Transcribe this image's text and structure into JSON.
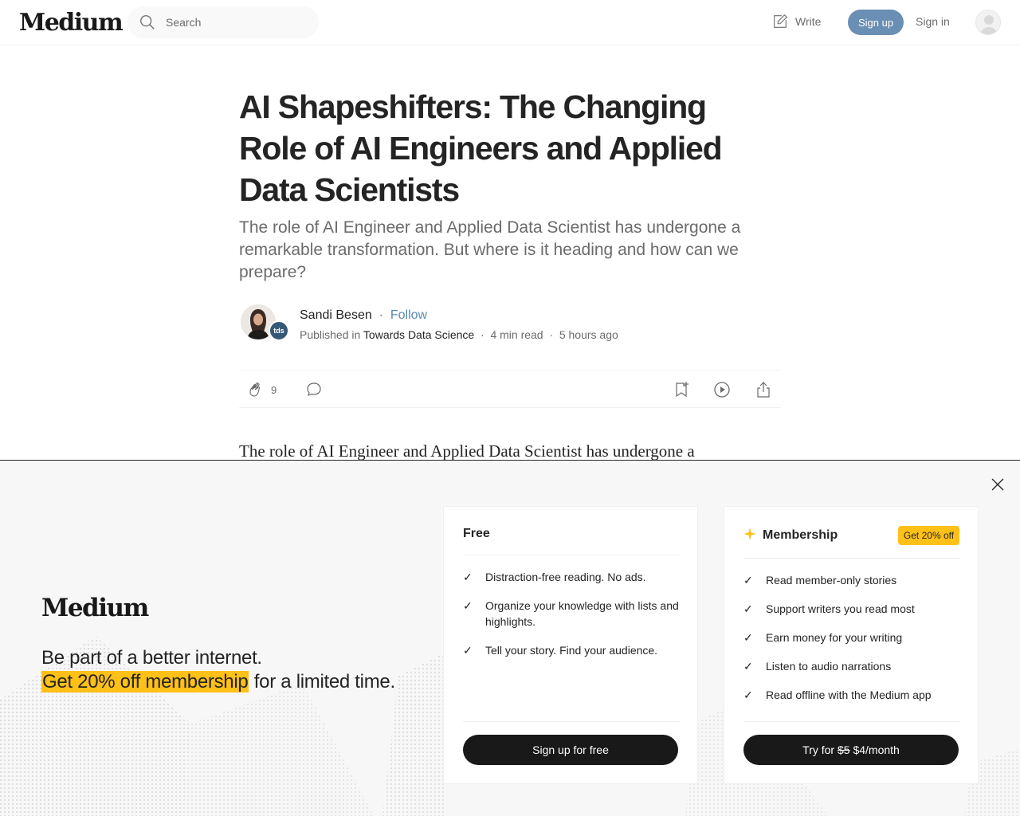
{
  "header": {
    "logo": "Medium",
    "search_placeholder": "Search",
    "write_label": "Write",
    "signup_label": "Sign up",
    "signin_label": "Sign in"
  },
  "article": {
    "title": "AI Shapeshifters: The Changing Role of AI Engineers and Applied Data Scientists",
    "subtitle": "The role of AI Engineer and Applied Data Scientist has undergone a remarkable transformation. But where is it heading and how can we prepare?",
    "author": "Sandi Besen",
    "follow_label": "Follow",
    "publication_badge": "tds",
    "published_in_label": "Published in",
    "publication": "Towards Data Science",
    "read_time": "4 min read",
    "published_ago": "5 hours ago",
    "claps": "9",
    "body_first_line": "The role of AI Engineer and Applied Data Scientist has undergone a"
  },
  "overlay": {
    "logo": "Medium",
    "tagline": "Be part of a better internet.",
    "offer_highlight": "Get 20% off membership",
    "offer_rest": "for a limited time.",
    "free_card": {
      "title": "Free",
      "features": [
        "Distraction-free reading. No ads.",
        "Organize your knowledge with lists and highlights.",
        "Tell your story. Find your audience."
      ],
      "button": "Sign up for free"
    },
    "member_card": {
      "title": "Membership",
      "badge": "Get 20% off",
      "features": [
        "Read member-only stories",
        "Support writers you read most",
        "Earn money for your writing",
        "Listen to audio narrations",
        "Read offline with the Medium app"
      ],
      "button_prefix": "Try for ",
      "button_old_price": "$5",
      "button_new_price": " $4/month"
    }
  },
  "colors": {
    "signup_button": "#6a8fb4",
    "follow_link": "#5b8bb4",
    "highlight": "#ffc017",
    "dark_button": "#191919"
  }
}
